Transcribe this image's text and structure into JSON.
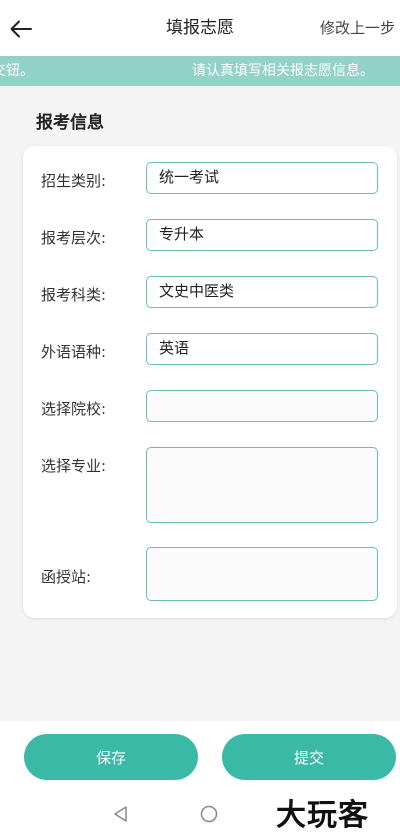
{
  "header": {
    "title": "填报志愿",
    "modify_link": "修改上一步",
    "back_icon": "arrow-left-icon"
  },
  "notice": {
    "text_tail": "交钮。",
    "text_head": "请认真填写相关报志愿信息。"
  },
  "section": {
    "title": "报考信息"
  },
  "form": {
    "category": {
      "label": "招生类别:",
      "value": "统一考试"
    },
    "level": {
      "label": "报考层次:",
      "value": "专升本"
    },
    "subject": {
      "label": "报考科类:",
      "value": "文史中医类"
    },
    "language": {
      "label": "外语语种:",
      "value": "英语"
    },
    "school": {
      "label": "选择院校:",
      "value": ""
    },
    "major": {
      "label": "选择专业:",
      "value": ""
    },
    "station": {
      "label": "函授站:",
      "value": ""
    }
  },
  "actions": {
    "save_label": "保存",
    "submit_label": "提交"
  },
  "nav": {
    "back_icon": "triangle-back-icon",
    "home_icon": "circle-home-icon"
  },
  "watermark": "大玩客",
  "colors": {
    "accent": "#3bb9a7",
    "notice_bg": "#92d2c9",
    "field_border": "#6dbeb3"
  }
}
